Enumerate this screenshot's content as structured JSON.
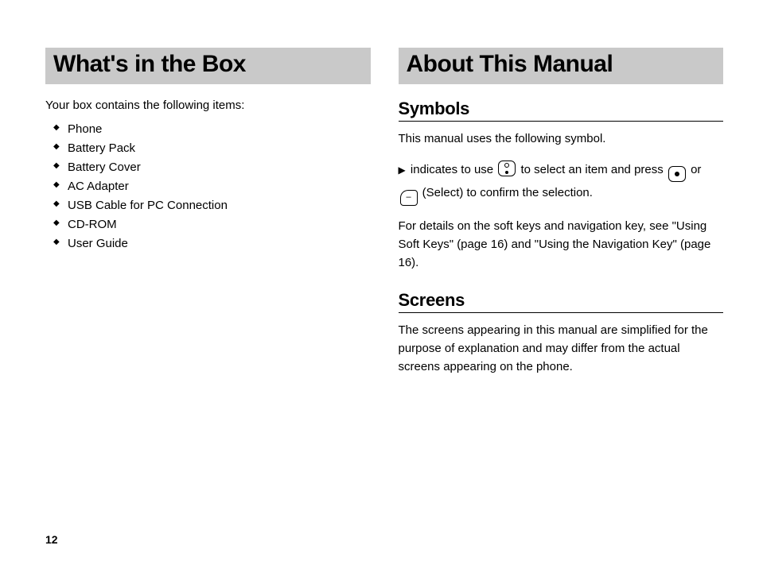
{
  "pageNumber": "12",
  "left": {
    "heading": "What's in the Box",
    "intro": "Your box contains the following items:",
    "items": [
      "Phone",
      "Battery Pack",
      "Battery Cover",
      "AC Adapter",
      "USB Cable for PC Connection",
      "CD-ROM",
      "User Guide"
    ]
  },
  "right": {
    "heading": "About This Manual",
    "symbols": {
      "title": "Symbols",
      "intro": "This manual uses the following symbol.",
      "line_pre": "indicates to use",
      "line_mid": "to select an item and press",
      "line_or": "or",
      "line_post": "(Select) to confirm the selection.",
      "details": "For details on the soft keys and navigation key, see \"Using Soft Keys\" (page 16) and \"Using the Navigation Key\" (page 16)."
    },
    "screens": {
      "title": "Screens",
      "body": "The screens appearing in this manual are simplified for the purpose of explanation and may differ from the actual screens appearing on the phone."
    }
  }
}
